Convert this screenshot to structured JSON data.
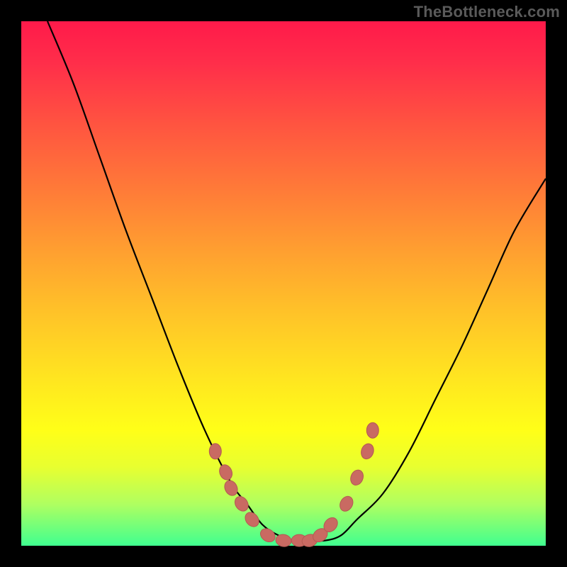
{
  "watermark": "TheBottleneck.com",
  "colors": {
    "gradient_top": "#ff1a4a",
    "gradient_mid": "#ffe520",
    "gradient_bottom": "#40ff90",
    "curve": "#000000",
    "dots": "#c96a62",
    "dots_stroke": "#b35a52"
  },
  "chart_data": {
    "type": "line",
    "title": "",
    "xlabel": "",
    "ylabel": "",
    "xlim": [
      0,
      100
    ],
    "ylim": [
      0,
      100
    ],
    "grid": false,
    "legend": false,
    "series": [
      {
        "name": "curve",
        "x": [
          5,
          10,
          15,
          20,
          25,
          30,
          35,
          40,
          43,
          46,
          49,
          52,
          55,
          58,
          61,
          64,
          69,
          74,
          79,
          84,
          89,
          94,
          100
        ],
        "values": [
          100,
          88,
          74,
          60,
          47,
          34,
          22,
          12,
          8,
          4,
          2,
          1,
          1,
          1,
          2,
          5,
          10,
          18,
          28,
          38,
          49,
          60,
          70
        ]
      }
    ],
    "highlighted_points": {
      "name": "dots",
      "x": [
        37,
        39,
        40,
        42,
        44,
        47,
        50,
        53,
        55,
        57,
        59,
        62,
        64,
        66,
        67
      ],
      "values": [
        18,
        14,
        11,
        8,
        5,
        2,
        1,
        1,
        1,
        2,
        4,
        8,
        13,
        18,
        22
      ]
    }
  }
}
